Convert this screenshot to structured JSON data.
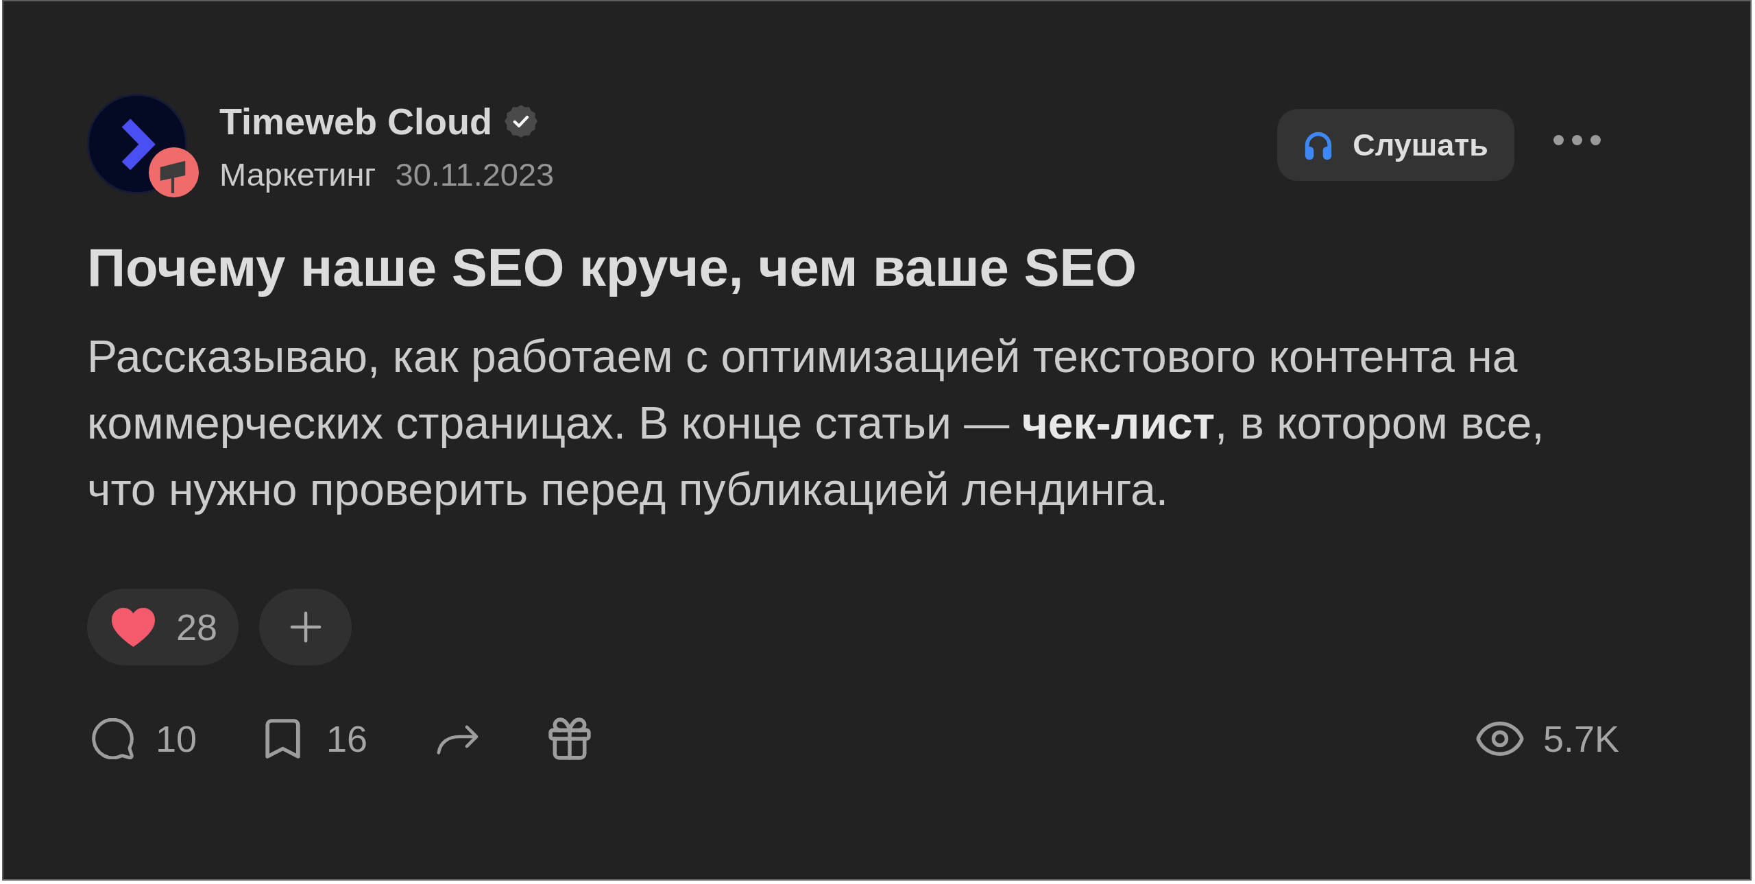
{
  "author": {
    "name": "Timeweb Cloud",
    "verified": true,
    "hub": "Маркетинг",
    "date": "30.11.2023"
  },
  "listen_button": {
    "label": "Слушать"
  },
  "title": "Почему наше SEO круче, чем ваше SEO",
  "lead": "Рассказываю, как работаем с оптимизацией текстового контента на коммерческих страницах. В конце статьи — **чек-лист**, в котором все, что нужно проверить перед публикацией лендинга.",
  "reactions": [
    {
      "kind": "heart",
      "count": "28"
    },
    {
      "kind": "add"
    }
  ],
  "stats": [
    {
      "kind": "comments",
      "count": "10"
    },
    {
      "kind": "bookmarks",
      "count": "16"
    },
    {
      "kind": "share"
    },
    {
      "kind": "gift"
    }
  ],
  "views": {
    "count": "5.7K"
  }
}
